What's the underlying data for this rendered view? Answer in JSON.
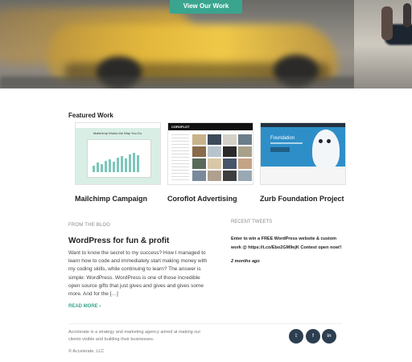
{
  "hero": {
    "cta_label": "View Our Work"
  },
  "featured": {
    "title": "Featured Work",
    "items": [
      {
        "name": "Mailchimp Campaign",
        "thumb_heading": "Mailchimp Works the Way You Do"
      },
      {
        "name": "Coroflot Advertising",
        "thumb_logo": "COROFLOT"
      },
      {
        "name": "Zurb Foundation Project",
        "thumb_title": "Foundation"
      }
    ]
  },
  "blog": {
    "label": "FROM THE BLOG",
    "title": "WordPress for fun & profit",
    "excerpt": "Want to know the secret to my success? How I managed to learn how to code and immediately start making money with my coding skills, while continuing to learn? The answer is simple: WordPress. WordPress is one of those incredible open source gifts that just gives and gives and gives some more. And for the […]",
    "read_more": "READ MORE ›"
  },
  "tweets": {
    "label": "RECENT TWEETS",
    "text": "Enter to win a FREE WordPress website & custom work @ https://t.co/Ebo2GM9ejK Contest open now!!",
    "time": "2 months ago"
  },
  "footer": {
    "about": "Accelerate is a strategy and marketing agency aimed at making our clients visible and building their businesses.",
    "copyright": "© Accelerate, LLC",
    "social": [
      {
        "icon": "twitter-icon",
        "glyph": "𝕥"
      },
      {
        "icon": "facebook-icon",
        "glyph": "f"
      },
      {
        "icon": "linkedin-icon",
        "glyph": "in"
      }
    ]
  },
  "colors": {
    "accent": "#3aa58f",
    "social_bg": "#2c3e50"
  }
}
